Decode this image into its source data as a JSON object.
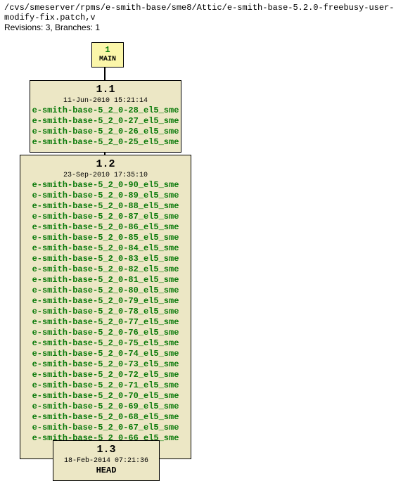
{
  "path": "/cvs/smeserver/rpms/e-smith-base/sme8/Attic/e-smith-base-5.2.0-freebusy-user-modify-fix.patch,v",
  "summary": "Revisions: 3, Branches: 1",
  "root": {
    "num": "1",
    "label": "MAIN"
  },
  "revs": [
    {
      "id": "1.1",
      "date": "11-Jun-2010 15:21:14",
      "tags": [
        "e-smith-base-5_2_0-28_el5_sme",
        "e-smith-base-5_2_0-27_el5_sme",
        "e-smith-base-5_2_0-26_el5_sme",
        "e-smith-base-5_2_0-25_el5_sme"
      ]
    },
    {
      "id": "1.2",
      "date": "23-Sep-2010 17:35:10",
      "tags": [
        "e-smith-base-5_2_0-90_el5_sme",
        "e-smith-base-5_2_0-89_el5_sme",
        "e-smith-base-5_2_0-88_el5_sme",
        "e-smith-base-5_2_0-87_el5_sme",
        "e-smith-base-5_2_0-86_el5_sme",
        "e-smith-base-5_2_0-85_el5_sme",
        "e-smith-base-5_2_0-84_el5_sme",
        "e-smith-base-5_2_0-83_el5_sme",
        "e-smith-base-5_2_0-82_el5_sme",
        "e-smith-base-5_2_0-81_el5_sme",
        "e-smith-base-5_2_0-80_el5_sme",
        "e-smith-base-5_2_0-79_el5_sme",
        "e-smith-base-5_2_0-78_el5_sme",
        "e-smith-base-5_2_0-77_el5_sme",
        "e-smith-base-5_2_0-76_el5_sme",
        "e-smith-base-5_2_0-75_el5_sme",
        "e-smith-base-5_2_0-74_el5_sme",
        "e-smith-base-5_2_0-73_el5_sme",
        "e-smith-base-5_2_0-72_el5_sme",
        "e-smith-base-5_2_0-71_el5_sme",
        "e-smith-base-5_2_0-70_el5_sme",
        "e-smith-base-5_2_0-69_el5_sme",
        "e-smith-base-5_2_0-68_el5_sme",
        "e-smith-base-5_2_0-67_el5_sme",
        "e-smith-base-5_2_0-66_el5_sme"
      ],
      "ellipsis": "..."
    },
    {
      "id": "1.3",
      "date": "18-Feb-2014 07:21:36",
      "tags": [],
      "head": "HEAD"
    }
  ]
}
